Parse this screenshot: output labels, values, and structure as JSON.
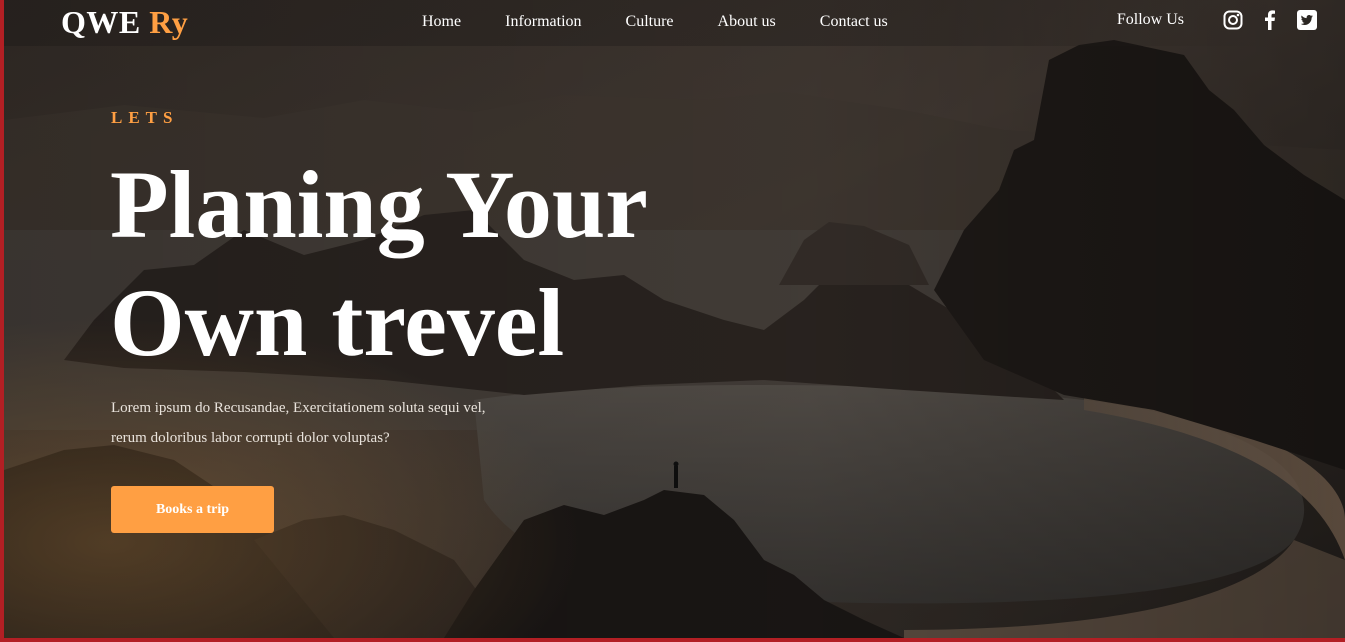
{
  "brand": {
    "logo_main": "QWE",
    "logo_accent": "Ry",
    "accent_color": "#ff9f43"
  },
  "nav": {
    "items": [
      {
        "label": "Home"
      },
      {
        "label": "Information"
      },
      {
        "label": "Culture"
      },
      {
        "label": "About us"
      },
      {
        "label": "Contact us"
      }
    ]
  },
  "social": {
    "follow_label": "Follow Us",
    "icons": [
      "instagram-icon",
      "facebook-icon",
      "twitter-icon"
    ]
  },
  "hero": {
    "kicker": "LETS",
    "headline_line1": "Planing Your",
    "headline_line2": "Own trevel",
    "description_line1": "Lorem ipsum do Recusandae, Exercitationem soluta sequi vel,",
    "description_line2": "rerum doloribus labor corrupti dolor voluptas?",
    "cta_label": "Books a trip"
  }
}
